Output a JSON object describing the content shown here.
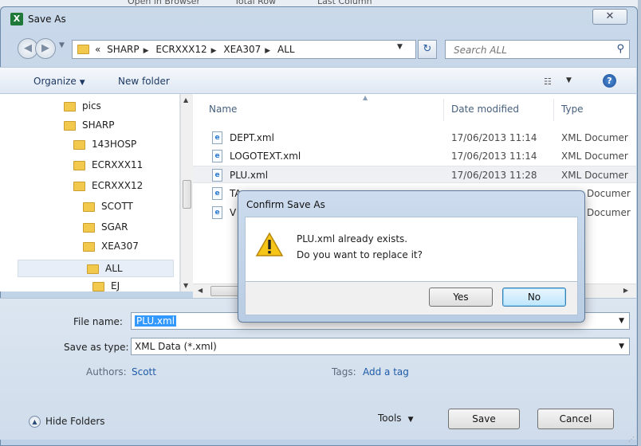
{
  "background": {
    "ribbon_items": [
      "Open in Browser",
      "Total Row",
      "Last Column"
    ]
  },
  "window": {
    "title": "Save As",
    "app_icon_letter": "X",
    "close_glyph": "✕"
  },
  "address": {
    "path_prefix": "«",
    "crumbs": [
      "SHARP",
      "ECRXXX12",
      "XEA307",
      "ALL"
    ],
    "search_placeholder": "Search ALL"
  },
  "toolbar": {
    "organize_label": "Organize",
    "new_folder_label": "New folder",
    "help_glyph": "?"
  },
  "tree": {
    "items": [
      {
        "label": "pics",
        "level": 1
      },
      {
        "label": "SHARP",
        "level": 1
      },
      {
        "label": "143HOSP",
        "level": 2
      },
      {
        "label": "ECRXXX11",
        "level": 2
      },
      {
        "label": "ECRXXX12",
        "level": 2
      },
      {
        "label": "SCOTT",
        "level": 3
      },
      {
        "label": "SGAR",
        "level": 3
      },
      {
        "label": "XEA307",
        "level": 3
      },
      {
        "label": "ALL",
        "level": 4,
        "selected": true
      },
      {
        "label": "EJ",
        "level": 4
      }
    ]
  },
  "filelist": {
    "columns": {
      "name": "Name",
      "date": "Date modified",
      "type": "Type"
    },
    "files": [
      {
        "name": "DEPT.xml",
        "date": "17/06/2013 11:14",
        "type": "XML Documer"
      },
      {
        "name": "LOGOTEXT.xml",
        "date": "17/06/2013 11:14",
        "type": "XML Documer"
      },
      {
        "name": "PLU.xml",
        "date": "17/06/2013 11:28",
        "type": "XML Documer",
        "selected": true
      },
      {
        "name": "TA",
        "date": "",
        "type": "Documer"
      },
      {
        "name": "V",
        "date": "",
        "type": "Documer"
      }
    ]
  },
  "form": {
    "filename_label": "File name:",
    "filename_value": "PLU.xml",
    "savetype_label": "Save as type:",
    "savetype_value": "XML Data (*.xml)",
    "authors_label": "Authors:",
    "authors_value": "Scott",
    "tags_label": "Tags:",
    "tags_value": "Add a tag"
  },
  "footer": {
    "hide_folders_label": "Hide Folders",
    "tools_label": "Tools",
    "save_label": "Save",
    "cancel_label": "Cancel"
  },
  "confirm": {
    "title": "Confirm Save As",
    "message_line1": "PLU.xml already exists.",
    "message_line2": "Do you want to replace it?",
    "yes_label": "Yes",
    "no_label": "No"
  }
}
